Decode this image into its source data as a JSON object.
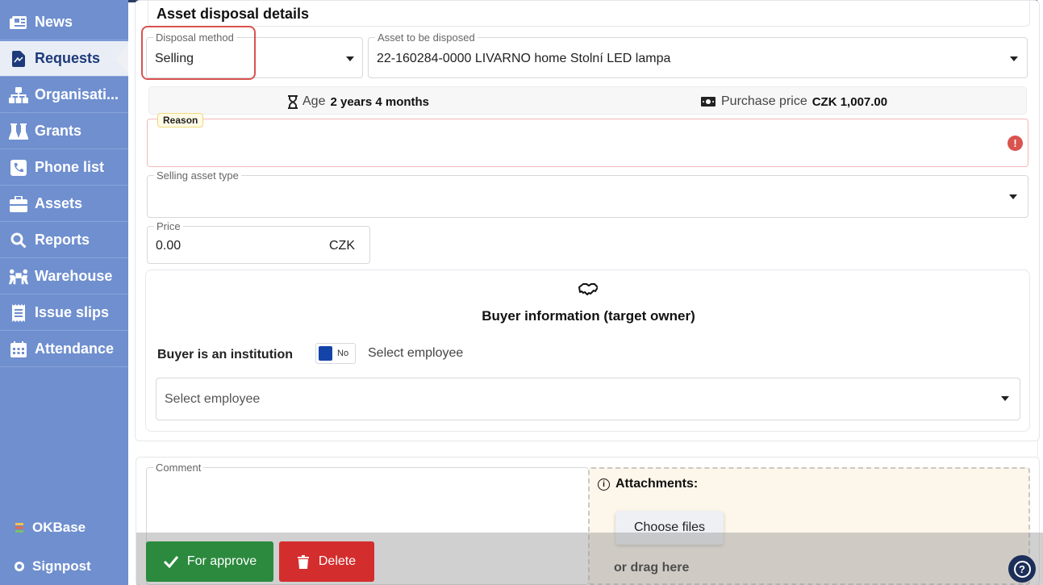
{
  "sidebar": {
    "items": [
      {
        "label": "News",
        "icon": "newspaper-icon"
      },
      {
        "label": "Requests",
        "icon": "file-icon",
        "active": true
      },
      {
        "label": "Organisati...",
        "icon": "sitemap-icon"
      },
      {
        "label": "Grants",
        "icon": "flask-icon"
      },
      {
        "label": "Phone list",
        "icon": "phone-icon"
      },
      {
        "label": "Assets",
        "icon": "briefcase-icon"
      },
      {
        "label": "Reports",
        "icon": "search-icon"
      },
      {
        "label": "Warehouse",
        "icon": "people-carry-icon"
      },
      {
        "label": "Issue slips",
        "icon": "receipt-icon"
      },
      {
        "label": "Attendance",
        "icon": "calendar-icon"
      }
    ],
    "bottom": [
      {
        "label": "OKBase",
        "icon": "okbase-icon"
      },
      {
        "label": "Signpost",
        "icon": "signpost-icon"
      }
    ]
  },
  "form": {
    "title": "Asset disposal details",
    "disposal_method": {
      "label": "Disposal method",
      "value": "Selling"
    },
    "asset": {
      "label": "Asset to be disposed",
      "value": "22-160284-0000 LIVARNO home Stolní LED lampa"
    },
    "age": {
      "label": "Age",
      "value": "2 years 4 months"
    },
    "purchase_price": {
      "label": "Purchase price",
      "value": "CZK 1,007.00"
    },
    "reason": {
      "label": "Reason",
      "value": ""
    },
    "selling_asset_type": {
      "label": "Selling asset type",
      "value": ""
    },
    "price": {
      "label": "Price",
      "value": "0.00",
      "currency": "CZK"
    },
    "buyer": {
      "title": "Buyer information (target owner)",
      "institution_label": "Buyer is an institution",
      "toggle_text": "No",
      "select_employee_label": "Select employee",
      "select_employee_placeholder": "Select employee"
    },
    "comment": {
      "label": "Comment",
      "value": ""
    },
    "attachments": {
      "title": "Attachments:",
      "choose_label": "Choose files",
      "drag_label": "or drag here"
    }
  },
  "actions": {
    "approve_label": "For approve",
    "delete_label": "Delete"
  },
  "colors": {
    "sidebar": "#6f8fcf",
    "approve": "#2b8a3e",
    "delete": "#d42d2d",
    "error": "#d9534f"
  }
}
